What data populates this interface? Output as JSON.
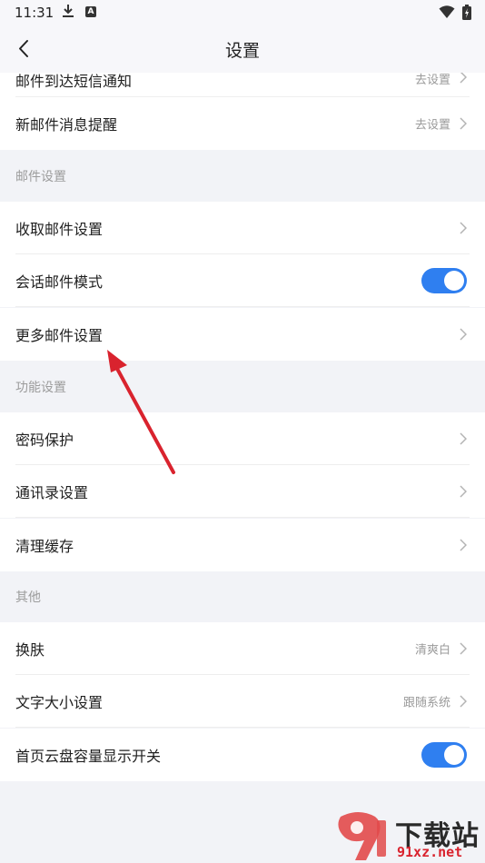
{
  "status_bar": {
    "time": "11:31",
    "download_icon": "download-icon",
    "a_badge": "A",
    "wifi_icon": "wifi-icon",
    "battery_icon": "battery-charging-icon"
  },
  "header": {
    "title": "设置",
    "back_icon": "chevron-left-icon"
  },
  "rows_top": [
    {
      "label": "邮件到达短信通知",
      "value": "去设置"
    },
    {
      "label": "新邮件消息提醒",
      "value": "去设置"
    }
  ],
  "section_mail": {
    "title": "邮件设置",
    "items": [
      {
        "label": "收取邮件设置",
        "value": ""
      },
      {
        "label": "会话邮件模式",
        "toggle": true
      },
      {
        "label": "更多邮件设置",
        "value": ""
      }
    ]
  },
  "section_func": {
    "title": "功能设置",
    "items": [
      {
        "label": "密码保护"
      },
      {
        "label": "通讯录设置"
      },
      {
        "label": "清理缓存"
      }
    ]
  },
  "section_other": {
    "title": "其他",
    "items": [
      {
        "label": "换肤",
        "value": "清爽白"
      },
      {
        "label": "文字大小设置",
        "value": "跟随系统"
      },
      {
        "label": "首页云盘容量显示开关",
        "toggle": true
      }
    ]
  },
  "watermark": {
    "line1": "下载站",
    "line2": "91xz.net"
  },
  "colors": {
    "accent": "#2f7ff0",
    "annotation_arrow": "#d9232e",
    "background": "#f2f3f7"
  }
}
